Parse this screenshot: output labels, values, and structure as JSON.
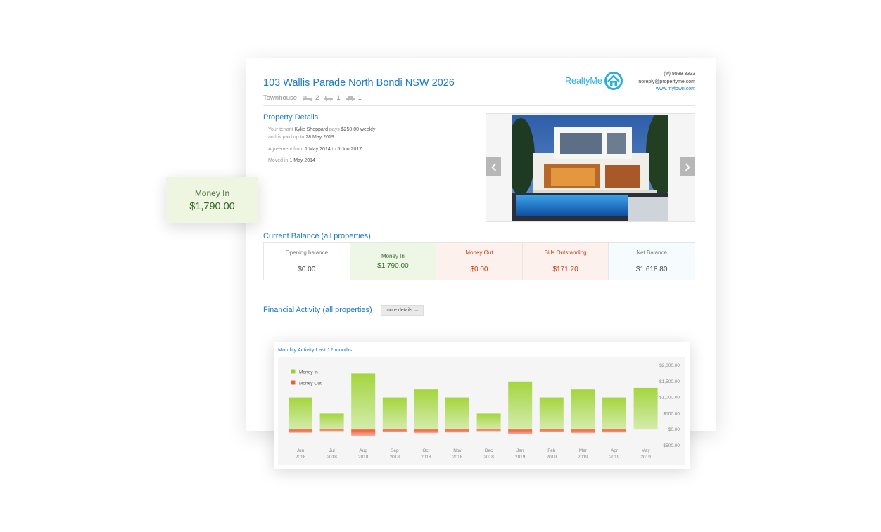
{
  "header": {
    "address": "103 Wallis Parade North Bondi NSW 2026",
    "property_type": "Townhouse",
    "bedrooms": "2",
    "bathrooms": "1",
    "car_spaces": "1",
    "brand": "RealtyMe",
    "phone": "(w) 9999 3333",
    "email": "noreply@propertyme.com",
    "website": "www.mytown.com"
  },
  "property_details": {
    "title": "Property Details",
    "tenant_prefix": "Your tenant",
    "tenant_name": "Kylie Sheppard",
    "pays_word": "pays",
    "rent": "$250.00 weekly",
    "paid_up_prefix": "and is paid up to",
    "paid_up_date": "28 May 2019",
    "agreement_prefix": "Agreement from",
    "agreement_start": "1 May 2014",
    "to_word": "to",
    "agreement_end": "5 Jun 2017",
    "moved_in_prefix": "Moved in",
    "moved_in_date": "1 May 2014"
  },
  "gallery": {
    "prev_icon": "chevron-left-icon",
    "next_icon": "chevron-right-icon"
  },
  "balance": {
    "title": "Current Balance (all properties)",
    "items": [
      {
        "label": "Opening balance",
        "value": "$0.00"
      },
      {
        "label": "Money In",
        "value": "$1,790.00"
      },
      {
        "label": "Money Out",
        "value": "$0.00"
      },
      {
        "label": "Bills Outstanding",
        "value": "$171.20"
      },
      {
        "label": "Net Balance",
        "value": "$1,618.80"
      }
    ]
  },
  "activity": {
    "title": "Financial Activity (all properties)",
    "more_details": "more details →"
  },
  "floating_card": {
    "label": "Money In",
    "value": "$1,790.00"
  },
  "colors": {
    "accent": "#1c7cc6",
    "money_in": "#9acd32",
    "money_out": "#ef5a3a"
  },
  "chart_data": {
    "type": "bar",
    "title": "Monthly Activity Last 12 months",
    "categories": [
      "Jun 2018",
      "Jul 2018",
      "Aug 2018",
      "Sep 2018",
      "Oct 2018",
      "Nov 2018",
      "Dec 2018",
      "Jan 2019",
      "Feb 2019",
      "Mar 2019",
      "Apr 2019",
      "May 2019"
    ],
    "series": [
      {
        "name": "Money In",
        "color": "#9acd32",
        "values": [
          1000,
          500,
          1750,
          1000,
          1250,
          1000,
          500,
          1500,
          1000,
          1250,
          1000,
          1300
        ]
      },
      {
        "name": "Money Out",
        "color": "#ef5a3a",
        "values": [
          -100,
          -50,
          -200,
          -80,
          -110,
          -90,
          -50,
          -150,
          -80,
          -110,
          -90,
          0
        ]
      }
    ],
    "y_ticks": [
      "$2,000.00",
      "$1,500.00",
      "$1,000.00",
      "$500.00",
      "$0.00",
      "-$500.00"
    ],
    "ylim": [
      -500,
      2000
    ],
    "legend_position": "top-left",
    "grid": false
  }
}
